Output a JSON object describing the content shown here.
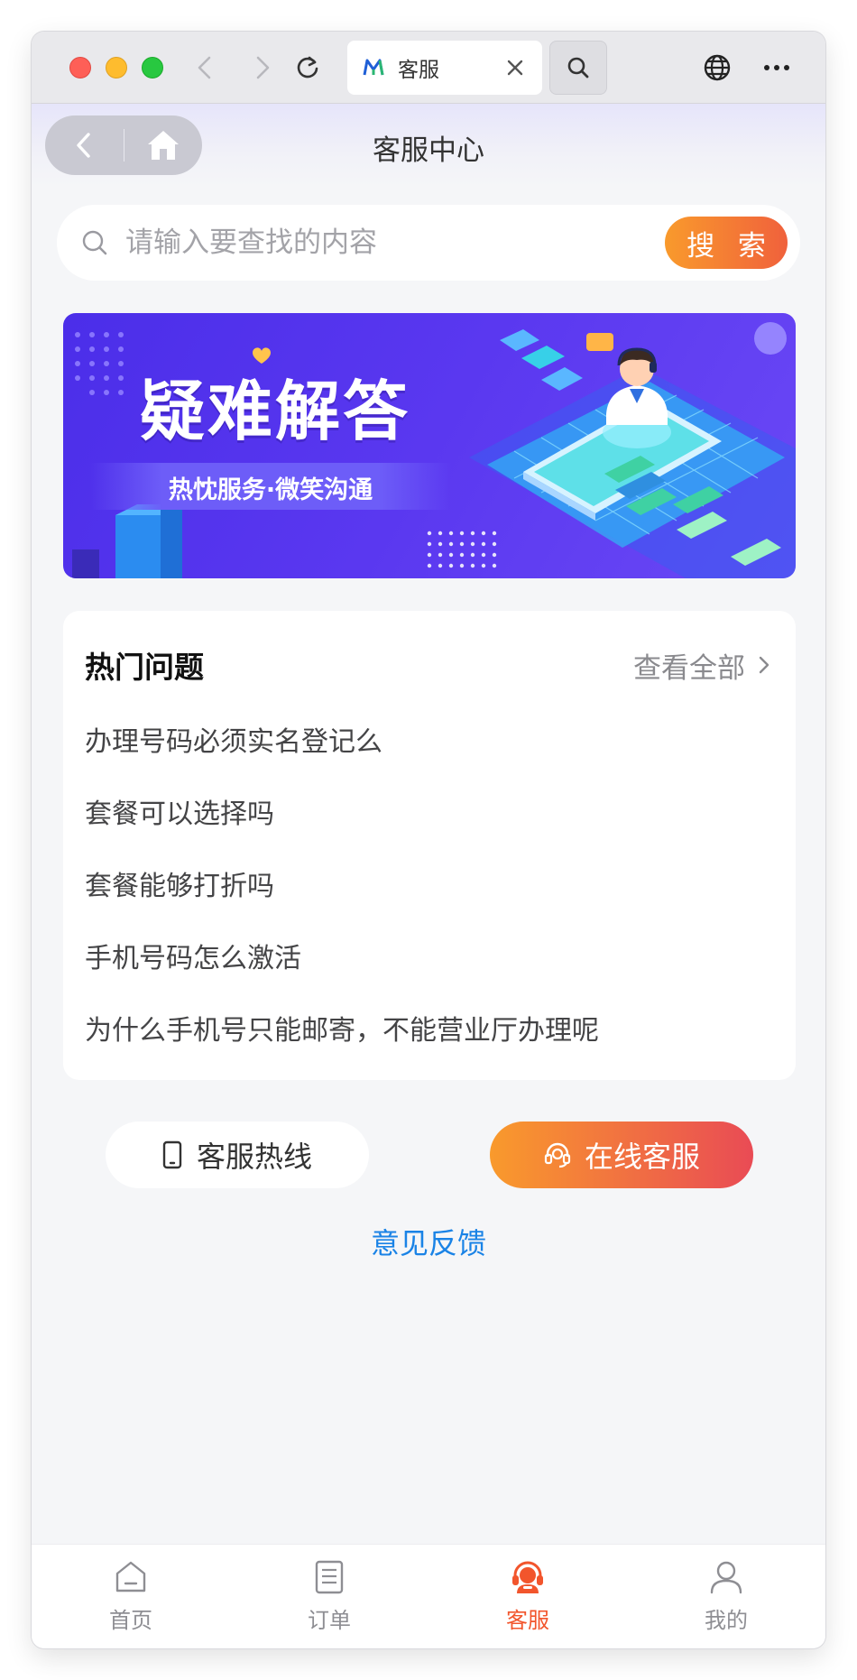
{
  "browser": {
    "tab_title": "客服",
    "icons": [
      "back-icon",
      "forward-icon",
      "reload-icon",
      "close-icon",
      "search-icon",
      "globe-icon",
      "more-icon"
    ]
  },
  "header": {
    "title": "客服中心"
  },
  "search": {
    "placeholder": "请输入要查找的内容",
    "button_label": "搜 索"
  },
  "banner": {
    "title": "疑难解答",
    "subtitle": "热忱服务·微笑沟通"
  },
  "faq": {
    "title": "热门问题",
    "view_all": "查看全部",
    "items": [
      "办理号码必须实名登记么",
      "套餐可以选择吗",
      "套餐能够打折吗",
      "手机号码怎么激活",
      "为什么手机号只能邮寄，不能营业厅办理呢"
    ]
  },
  "actions": {
    "hotline_label": "客服热线",
    "online_label": "在线客服",
    "feedback_label": "意见反馈"
  },
  "tabbar": {
    "items": [
      {
        "label": "首页",
        "icon": "home-icon",
        "active": false
      },
      {
        "label": "订单",
        "icon": "order-icon",
        "active": false
      },
      {
        "label": "客服",
        "icon": "customer-service-icon",
        "active": true
      },
      {
        "label": "我的",
        "icon": "profile-icon",
        "active": false
      }
    ]
  },
  "colors": {
    "accent_orange": "#f99a2c",
    "accent_red": "#f0613c",
    "active_tab": "#f2552c",
    "link_blue": "#1a83e6",
    "banner_purple": "#4b2ee9"
  }
}
